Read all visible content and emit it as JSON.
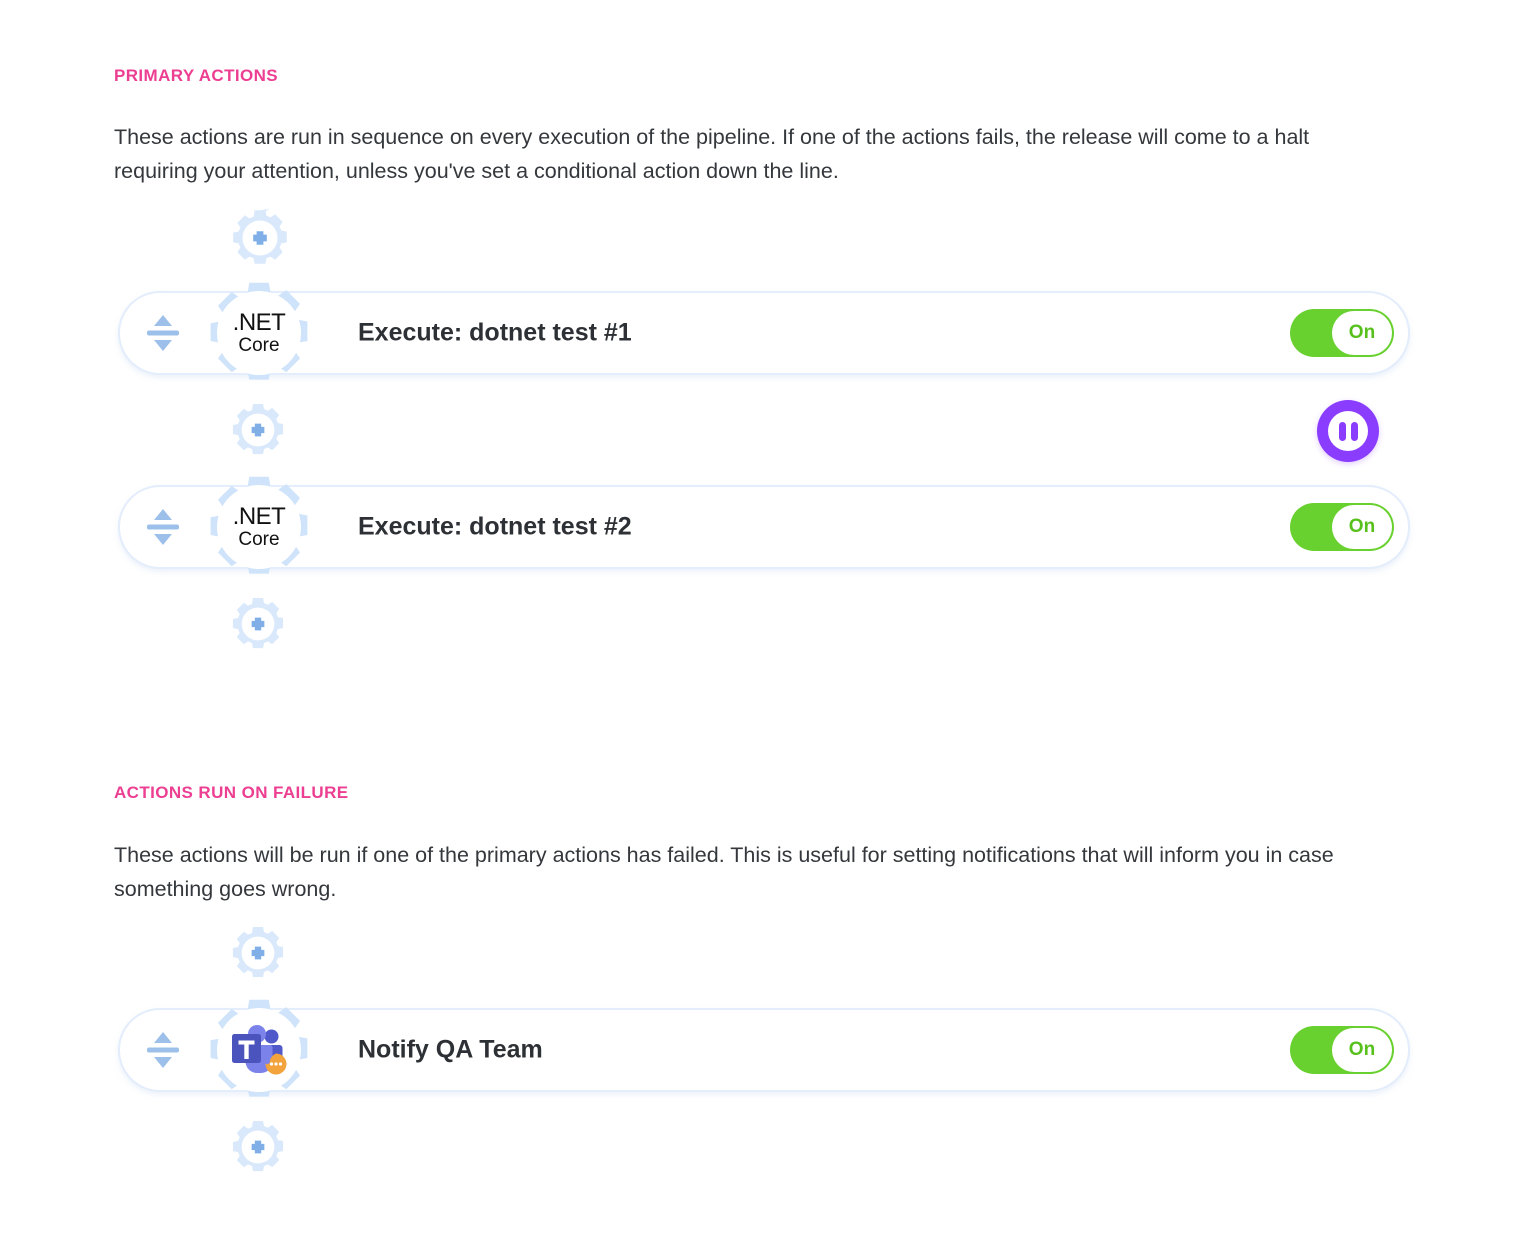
{
  "theme": {
    "accent_pink": "#ec3f92",
    "toggle_green": "#69d12f",
    "cog_blue": "#d6e7fa",
    "handle_blue": "#9dc0ea",
    "badge_purple": "#8b3dff",
    "row_border": "#e3edfb"
  },
  "sections": [
    {
      "id": "primary",
      "title": "PRIMARY ACTIONS",
      "description": "These actions are run in sequence on every execution of the pipeline. If one of the actions fails, the release will come to a halt requiring your attention, unless you've set a conditional action down the line.",
      "actions": [
        {
          "label": "Execute: dotnet test #1",
          "icon": "dotnet-core-icon",
          "icon_text_line1": ".NET",
          "icon_text_line2": "Core",
          "toggle_label": "On",
          "toggle_state": "on"
        },
        {
          "label": "Execute: dotnet test #2",
          "icon": "dotnet-core-icon",
          "icon_text_line1": ".NET",
          "icon_text_line2": "Core",
          "toggle_label": "On",
          "toggle_state": "on"
        }
      ]
    },
    {
      "id": "failure",
      "title": "ACTIONS RUN ON FAILURE",
      "description": "These actions will be run if one of the primary actions has failed. This is useful for setting notifications that will inform you in case something goes wrong.",
      "actions": [
        {
          "label": "Notify QA Team",
          "icon": "microsoft-teams-icon",
          "icon_text_line1": "",
          "icon_text_line2": "",
          "toggle_label": "On",
          "toggle_state": "on"
        }
      ]
    }
  ],
  "icons": {
    "add_action": "add-action-gear-icon",
    "reorder": "reorder-handle-icon",
    "conditional_pause": "pause-icon"
  }
}
